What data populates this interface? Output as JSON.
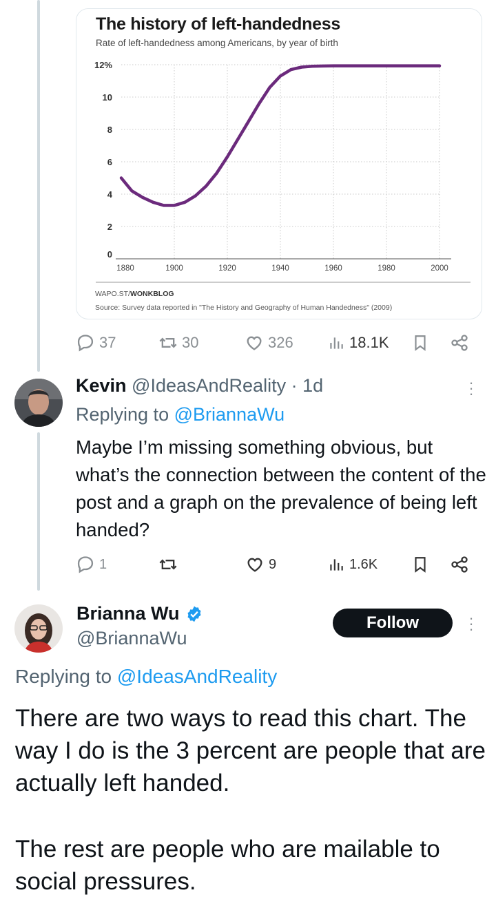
{
  "chart_card": {
    "credit_prefix": "WAPO.ST/",
    "credit_bold": "WONKBLOG",
    "source": "Source: Survey data reported in \"The History and Geography of Human Handedness\" (2009)"
  },
  "chart_data": {
    "type": "line",
    "title": "The history of left-handedness",
    "subtitle": "Rate of left-handedness among Americans, by year of birth",
    "xlabel": "",
    "ylabel": "",
    "xlim": [
      1880,
      2000
    ],
    "ylim": [
      0,
      12
    ],
    "x_ticks": [
      "1880",
      "1900",
      "1920",
      "1940",
      "1960",
      "1980",
      "2000"
    ],
    "y_ticks": [
      "0",
      "2",
      "4",
      "6",
      "8",
      "10",
      "12%"
    ],
    "series": [
      {
        "color": "#6b2a7c",
        "x": [
          1880,
          1884,
          1888,
          1892,
          1896,
          1900,
          1904,
          1908,
          1912,
          1916,
          1920,
          1924,
          1928,
          1932,
          1936,
          1940,
          1944,
          1948,
          1952,
          1956,
          1960,
          1966,
          1972,
          1980,
          1990,
          2000
        ],
        "y": [
          5.0,
          4.2,
          3.8,
          3.5,
          3.3,
          3.3,
          3.5,
          3.9,
          4.5,
          5.3,
          6.3,
          7.4,
          8.5,
          9.6,
          10.6,
          11.3,
          11.7,
          11.85,
          11.9,
          11.92,
          11.93,
          11.93,
          11.93,
          11.93,
          11.93,
          11.93
        ]
      }
    ],
    "grid": true,
    "legend": "none"
  },
  "tweet1_actions": {
    "replies": "37",
    "reposts": "30",
    "likes": "326",
    "views": "18.1K"
  },
  "reply1": {
    "name": "Kevin",
    "handle": "@IdeasAndReality",
    "time": "· 1d",
    "replying_prefix": "Replying to",
    "replying_to": "@BriannaWu",
    "text": "Maybe I’m missing something obvious, but what’s the connection between the content of the post and a graph on the prevalence of being left handed?",
    "actions": {
      "replies": "1",
      "reposts": "",
      "likes": "9",
      "views": "1.6K"
    }
  },
  "reply2": {
    "name": "Brianna Wu",
    "handle": "@BriannaWu",
    "follow_label": "Follow",
    "replying_prefix": "Replying to",
    "replying_to": "@IdeasAndReality",
    "text_p1": "There are two ways to read this chart. The way I do is the 3 percent are people that are actually left handed.",
    "text_p2": "The rest are people who are mailable to social pressures."
  },
  "colors": {
    "verified": "#1d9bf0",
    "link": "#1d9bf0",
    "line": "#6b2a7c",
    "follow_bg": "#0f1419"
  },
  "icons": [
    "reply-icon",
    "repost-icon",
    "like-icon",
    "views-icon",
    "bookmark-icon",
    "share-icon",
    "more-icon",
    "verified-badge-icon"
  ]
}
